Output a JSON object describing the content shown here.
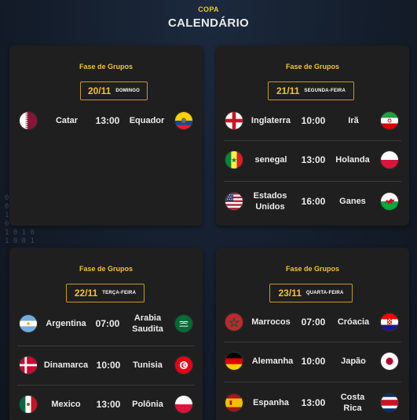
{
  "header": {
    "brand": "COPA",
    "title": "CALENDÁRIO"
  },
  "background_binary": [
    "0",
    "0  1",
    "1  0",
    "0 1 1 1",
    "1 0 1 0",
    "1 0 0 1"
  ],
  "cards": [
    {
      "phase": "Fase de Grupos",
      "date": "20/11",
      "weekday": "DOMINGO",
      "matches": [
        {
          "home": "Catar",
          "home_flag": "qatar-flag-icon",
          "time": "13:00",
          "away": "Equador",
          "away_flag": "ecuador-flag-icon"
        }
      ]
    },
    {
      "phase": "Fase de Grupos",
      "date": "21/11",
      "weekday": "SEGUNDA-FEIRA",
      "matches": [
        {
          "home": "Inglaterra",
          "home_flag": "england-flag-icon",
          "time": "10:00",
          "away": "Irã",
          "away_flag": "iran-flag-icon"
        },
        {
          "home": "senegal",
          "home_flag": "senegal-flag-icon",
          "time": "13:00",
          "away": "Holanda",
          "away_flag": "netherlands-flag-icon"
        },
        {
          "home": "Estados Unidos",
          "home_flag": "usa-flag-icon",
          "time": "16:00",
          "away": "Ganes",
          "away_flag": "wales-flag-icon"
        }
      ]
    },
    {
      "phase": "Fase de Grupos",
      "date": "22/11",
      "weekday": "TERÇA-FEIRA",
      "matches": [
        {
          "home": "Argentina",
          "home_flag": "argentina-flag-icon",
          "time": "07:00",
          "away": "Arabia Saudita",
          "away_flag": "saudi-arabia-flag-icon"
        },
        {
          "home": "Dinamarca",
          "home_flag": "denmark-flag-icon",
          "time": "10:00",
          "away": "Tunisia",
          "away_flag": "tunisia-flag-icon"
        },
        {
          "home": "Mexico",
          "home_flag": "mexico-flag-icon",
          "time": "13:00",
          "away": "Polônia",
          "away_flag": "poland-flag-icon"
        }
      ]
    },
    {
      "phase": "Fase de Grupos",
      "date": "23/11",
      "weekday": "QUARTA-FEIRA",
      "matches": [
        {
          "home": "Marrocos",
          "home_flag": "morocco-flag-icon",
          "time": "07:00",
          "away": "Cróacia",
          "away_flag": "croatia-flag-icon"
        },
        {
          "home": "Alemanha",
          "home_flag": "germany-flag-icon",
          "time": "10:00",
          "away": "Japão",
          "away_flag": "japan-flag-icon"
        },
        {
          "home": "Espanha",
          "home_flag": "spain-flag-icon",
          "time": "13:00",
          "away": "Costa Rica",
          "away_flag": "costa-rica-flag-icon"
        }
      ]
    }
  ]
}
